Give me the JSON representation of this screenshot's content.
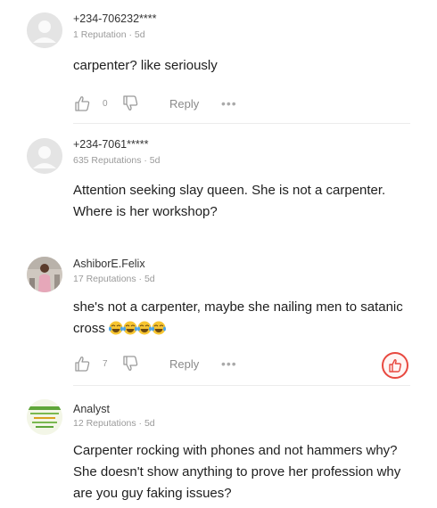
{
  "comments": [
    {
      "username": "+234-706232****",
      "meta": "1 Reputation · 5d",
      "text": "carpenter? like seriously",
      "likes": "0",
      "reply": "Reply",
      "more": "•••"
    },
    {
      "username": "+234-7061*****",
      "meta": "635 Reputations · 5d",
      "text": "Attention seeking slay queen. She is not a carpenter. Where is her workshop?"
    },
    {
      "username": "AshiborE.Felix",
      "meta": "17 Reputations · 5d",
      "text": "she's not a carpenter, maybe she nailing men to satanic cross",
      "likes": "7",
      "reply": "Reply",
      "more": "•••"
    },
    {
      "username": "Analyst",
      "meta": "12 Reputations · 5d",
      "text": "Carpenter rocking with phones and not hammers why? She doesn't show anything to prove her profession why are you guy faking issues?"
    }
  ],
  "colors": {
    "accent_red": "#e8483f",
    "meta_gray": "#9a9a9a",
    "divider": "#ececec"
  }
}
